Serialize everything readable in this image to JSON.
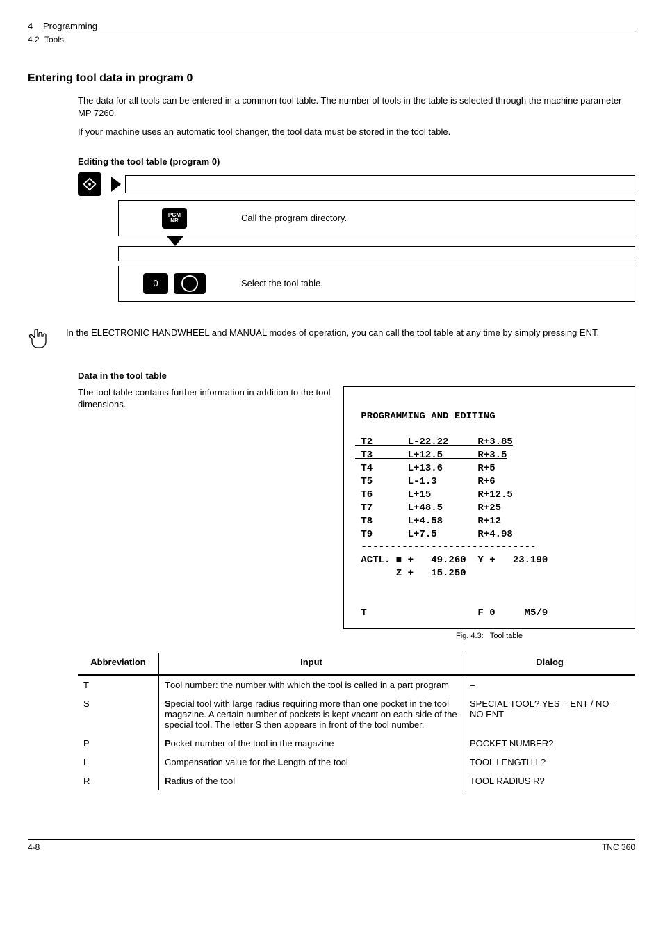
{
  "header": {
    "chapter_num": "4",
    "chapter_title": "Programming",
    "section_num": "4.2",
    "section_title": "Tools"
  },
  "headings": {
    "entering": "Entering tool data in program 0",
    "editing": "Editing the tool table (program 0)",
    "data_in_table": "Data in the tool table"
  },
  "paragraphs": {
    "intro1": "The data for all tools can be entered in a common tool table. The number of tools in the table is selected through the machine parameter MP 7260.",
    "intro2": "If your machine uses an automatic tool changer, the tool data must be stored in the tool table.",
    "note": "In the ELECTRONIC HANDWHEEL and MANUAL modes of operation, you can call the tool table at any time by simply pressing ENT.",
    "data_in_table_desc": "The tool table contains further information in addition to the tool dimensions."
  },
  "steps": {
    "s1": "Call the program directory.",
    "s2": "Select the tool table."
  },
  "icons": {
    "mode": "editing-mode-icon",
    "arrow": "right-arrow-icon",
    "pgm_key": "PGM\nNR",
    "zero_key": "0",
    "ent_key": "ENT",
    "hand": "pointing-hand-icon"
  },
  "screen": {
    "title": "PROGRAMMING AND EDITING",
    "rows": [
      {
        "t": "T2",
        "l": "L-22.22",
        "r": "R+3.85",
        "ul": true
      },
      {
        "t": "T3",
        "l": "L+12.5",
        "r": "R+3.5",
        "ul": true
      },
      {
        "t": "T4",
        "l": "L+13.6",
        "r": "R+5"
      },
      {
        "t": "T5",
        "l": "L-1.3",
        "r": "R+6"
      },
      {
        "t": "T6",
        "l": "L+15",
        "r": "R+12.5"
      },
      {
        "t": "T7",
        "l": "L+48.5",
        "r": "R+25"
      },
      {
        "t": "T8",
        "l": "L+4.58",
        "r": "R+12"
      },
      {
        "t": "T9",
        "l": "L+7.5",
        "r": "R+4.98"
      }
    ],
    "actl_line1": "ACTL. ■ +   49.260  Y +   23.190",
    "actl_line2": "      Z +   15.250",
    "status": " T                   F 0     M5/9"
  },
  "caption": {
    "label": "Fig. 4.3:",
    "text": "Tool table"
  },
  "table": {
    "headers": {
      "abbr": "Abbreviation",
      "input": "Input",
      "dialog": "Dialog"
    },
    "rows": [
      {
        "abbr": "T",
        "input_b": "T",
        "input_rest": "ool number: the number with which the tool is called in a part program",
        "dialog": "–"
      },
      {
        "abbr": "S",
        "input_b": "S",
        "input_rest": "pecial tool with large radius requiring more than one pocket in the tool magazine. A certain number of pockets is kept vacant on each side of the special tool. The letter S then appears in front of the tool number.",
        "dialog": "SPECIAL TOOL? YES = ENT / NO = NO ENT"
      },
      {
        "abbr": "P",
        "input_b": "P",
        "input_rest": "ocket number of the tool in the magazine",
        "dialog": "POCKET NUMBER?"
      },
      {
        "abbr": "L",
        "input_pre": "Compensation value for the ",
        "input_b": "L",
        "input_rest": "ength of the tool",
        "dialog": "TOOL LENGTH L?"
      },
      {
        "abbr": "R",
        "input_b": "R",
        "input_rest": "adius of the tool",
        "dialog": "TOOL RADIUS R?"
      }
    ]
  },
  "footer": {
    "page": "4-8",
    "model": "TNC 360"
  },
  "chart_data": {
    "type": "table",
    "title": "Tool table (program 0)",
    "columns": [
      "Tool",
      "L",
      "R"
    ],
    "rows": [
      [
        "T2",
        -22.22,
        3.85
      ],
      [
        "T3",
        12.5,
        3.5
      ],
      [
        "T4",
        13.6,
        5
      ],
      [
        "T5",
        -1.3,
        6
      ],
      [
        "T6",
        15,
        12.5
      ],
      [
        "T7",
        48.5,
        25
      ],
      [
        "T8",
        4.58,
        12
      ],
      [
        "T9",
        7.5,
        4.98
      ]
    ],
    "actual_position": {
      "X": 49.26,
      "Y": 23.19,
      "Z": 15.25
    },
    "status": {
      "T": "",
      "F": 0,
      "M": "5/9"
    }
  }
}
